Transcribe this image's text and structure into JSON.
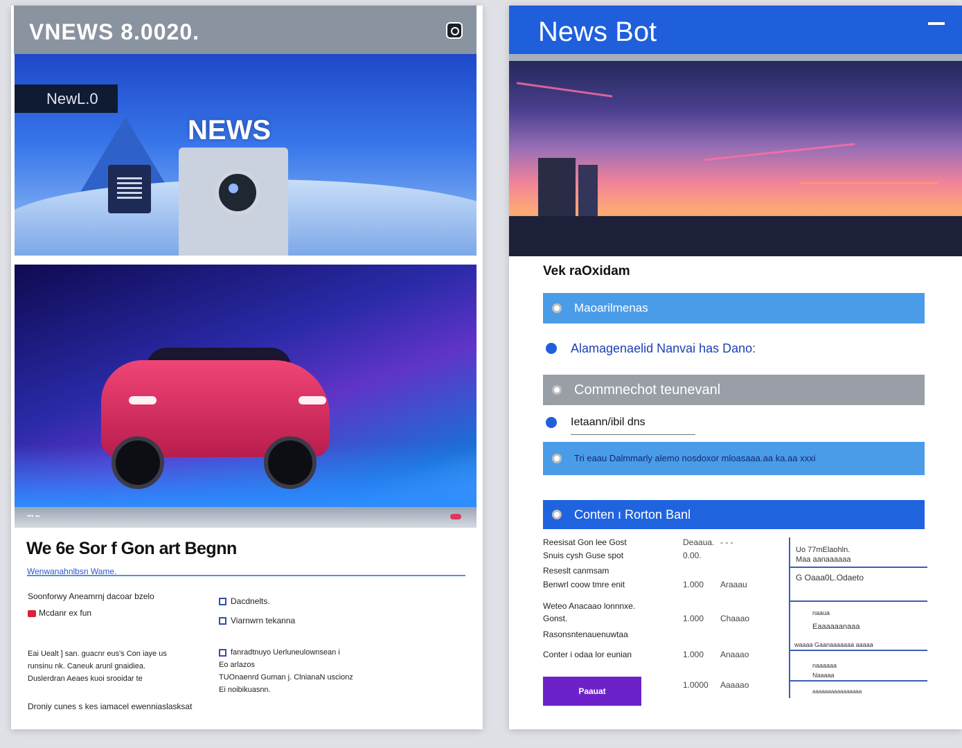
{
  "left": {
    "header_title": "VNEWS 8.0020.",
    "hero_badge": "NewL.0",
    "hero_sign": "NEWS",
    "strip_text": "••• ▪▪",
    "article_title": "We 6e Sor f Gon art Begnn",
    "article_link": "Wenwanahnlbsn Wame.",
    "col1_lines": [
      "Soonforwy Aneamrnj dacoar bzelo",
      "Mcdanr ex fun"
    ],
    "col1_para": [
      "Eai Uealt ] san. guacnr eus's Con iaye us",
      "runsinu nk. Caneuk arunl gnaidiea.",
      "Duslerdran Aeaes kuoi srooidar te"
    ],
    "col1_footer": "Droniy cunes s kes iamacel ewenniaslasksat",
    "col2_checks": [
      "Dacdnelts.",
      "Viarnwrn tekanna"
    ],
    "col2_para": [
      "fanradtnuyo Uerluneulownsean i",
      "Eo arlazos",
      "TUOnaenrd Guman j. ClnianaN uscionz",
      "Ei noibikuasnn."
    ]
  },
  "right": {
    "header_title": "News Bot",
    "section_title": "Vek raOxidam",
    "items": [
      {
        "label": "Maoarilmenas",
        "style": "blue"
      },
      {
        "label": "Alamagenaelid Nanvai has Dano:",
        "style": "plain"
      },
      {
        "label": "Commnechot teunevanl",
        "style": "gray"
      },
      {
        "label": "Ietaann/ibil dns",
        "style": "plain"
      },
      {
        "label": "Tri eaau Dalmmarly alemo nosdoxor mloasaaa.aa ka.aa xxxi",
        "style": "blue"
      }
    ],
    "content_bar": "Conten  ı  Rorton Banl",
    "table_rows": [
      {
        "a": "Reesisat Gon lee Gost",
        "b": "Deaaua.",
        "c": "- - -"
      },
      {
        "a": "Snuis cysh Guse spot",
        "b": "0.00.",
        "c": ""
      },
      {
        "a": "Reseslt canmsam",
        "b": "",
        "c": ""
      },
      {
        "a": "Benwrl coow tmre enit",
        "b": "1.000",
        "c": "Araaau"
      },
      {
        "a": "Weteo Anacaao lonnnxe.",
        "b": "",
        "c": ""
      },
      {
        "a": "Gonst.",
        "b": "1.000",
        "c": "Chaaao"
      },
      {
        "a": "Rasonsntenauenuwtaa",
        "b": "",
        "c": ""
      },
      {
        "a": "Conter i odaa lor eunian",
        "b": "1.000",
        "c": "Anaaao"
      },
      {
        "a": "",
        "b": "1.0000",
        "c": "Aaaaao"
      }
    ],
    "side_lines": [
      "Uo  77mElaohln.",
      "Maa  aanaaaaaa",
      "G   Oaaa0L.Odaeto",
      "naaua",
      "Eaaaaaanaaa",
      "waaaa Gaanaaaaaaa aaaaa",
      "naaaaaa",
      "Naaaaa",
      "aaaaaaaaaaaaaaaa"
    ],
    "submit_label": "Paauat"
  },
  "colors": {
    "left_header": "#8a93a0",
    "right_header": "#1f5fdc",
    "accent_blue": "#4a9ce8",
    "accent_gray": "#9a9ea6",
    "submit_purple": "#6d22c9"
  }
}
